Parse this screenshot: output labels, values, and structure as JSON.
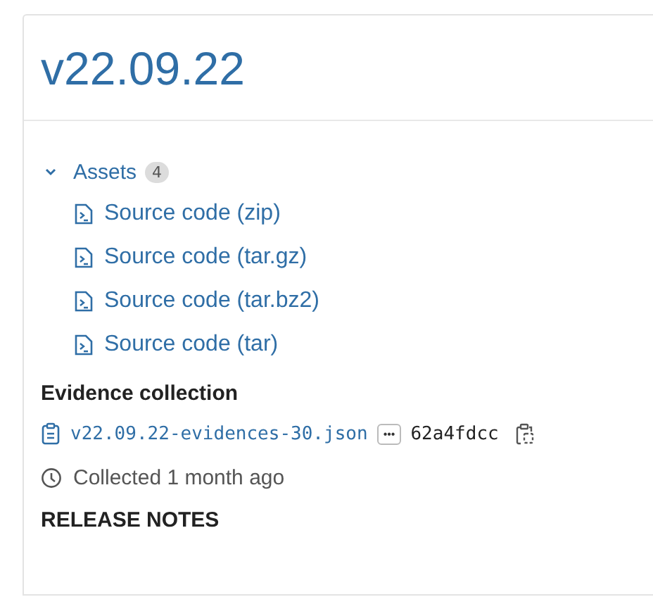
{
  "release": {
    "title": "v22.09.22"
  },
  "assets": {
    "label": "Assets",
    "count": "4",
    "expanded": true,
    "items": [
      {
        "label": "Source code (zip)"
      },
      {
        "label": "Source code (tar.gz)"
      },
      {
        "label": "Source code (tar.bz2)"
      },
      {
        "label": "Source code (tar)"
      }
    ]
  },
  "evidence": {
    "heading": "Evidence collection",
    "file": "v22.09.22-evidences-30.json",
    "more": "•••",
    "sha": "62a4fdcc",
    "collected": "Collected 1 month ago"
  },
  "release_notes": {
    "heading": "RELEASE NOTES"
  }
}
